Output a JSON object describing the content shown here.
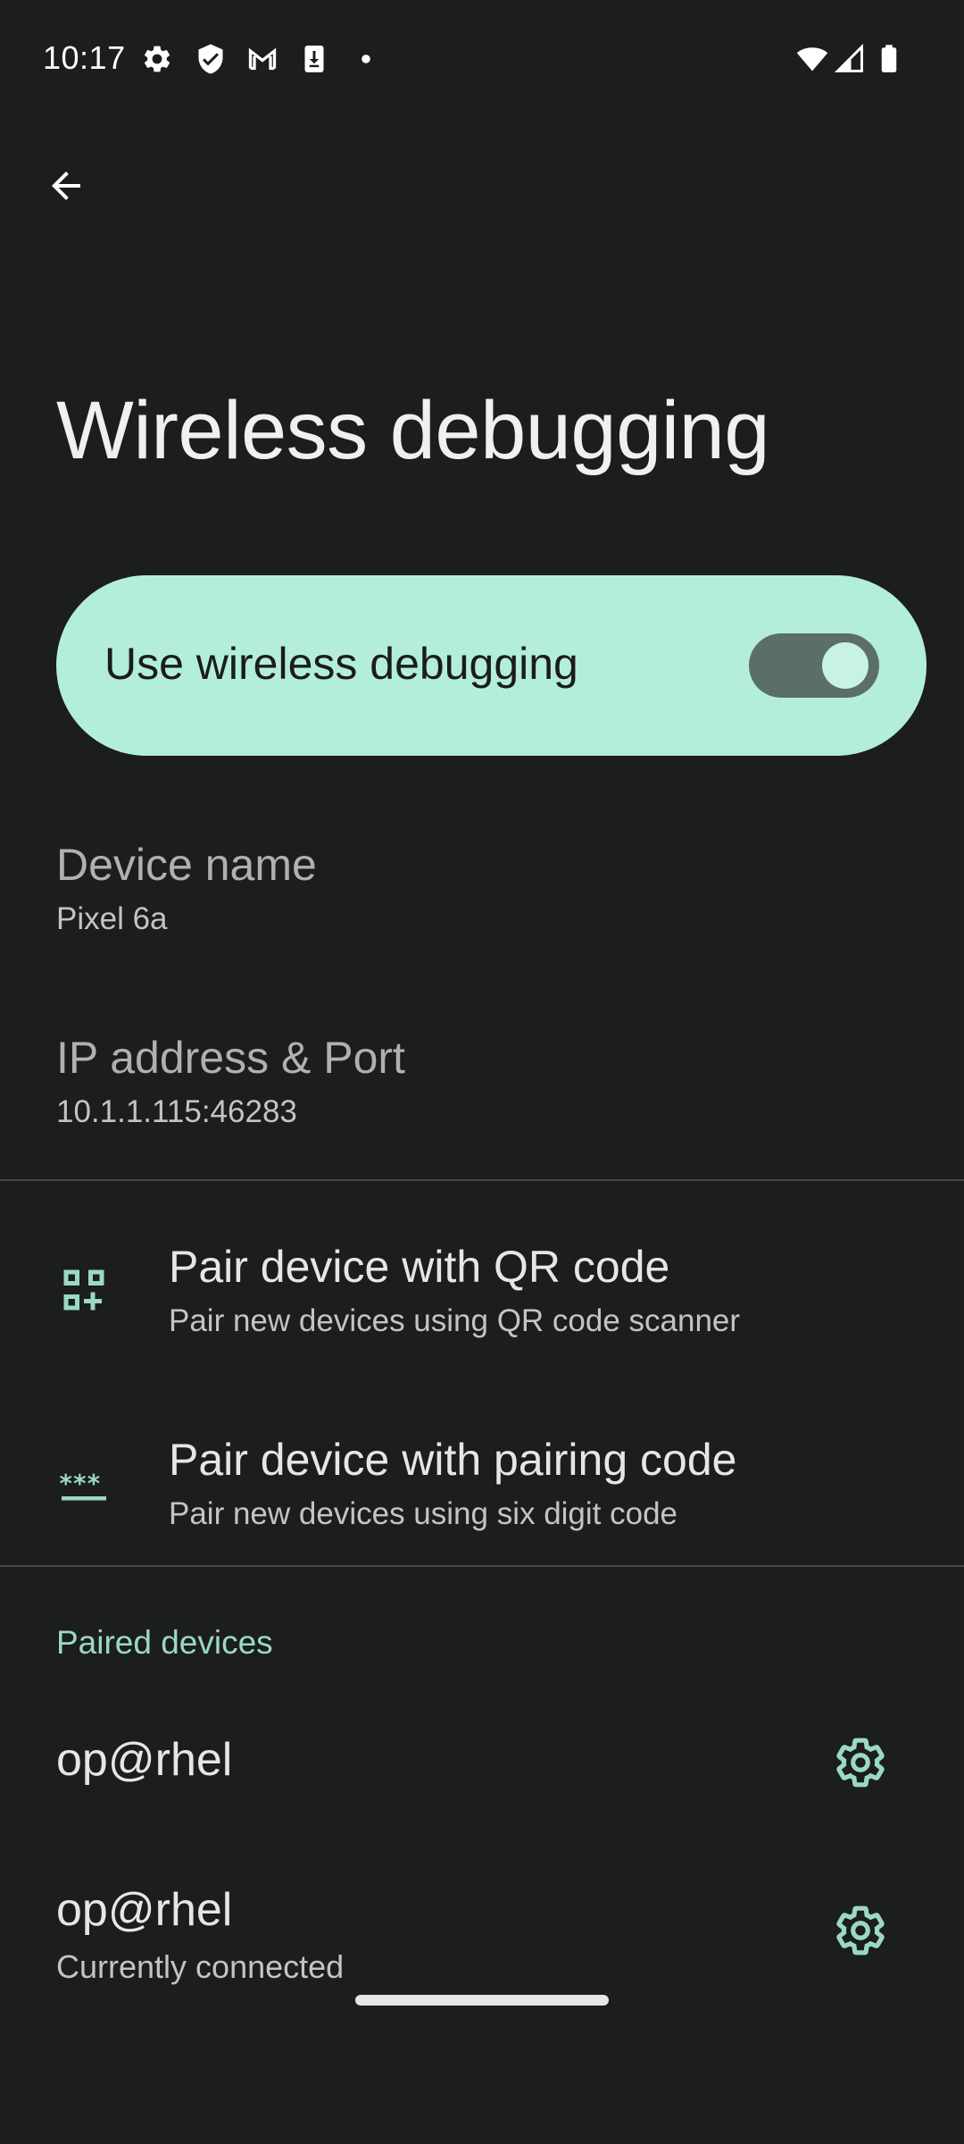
{
  "status_bar": {
    "time": "10:17",
    "left_icons": [
      "settings-gear-icon",
      "shield-icon",
      "gmail-icon",
      "download-icon",
      "notification-dot-icon"
    ],
    "right_icons": [
      "wifi-icon",
      "cell-signal-icon",
      "battery-icon"
    ]
  },
  "header": {
    "title": "Wireless debugging"
  },
  "main_switch": {
    "label": "Use wireless debugging",
    "enabled": true,
    "accent_color": "#b3eedb"
  },
  "info": {
    "device_name": {
      "title": "Device name",
      "value": "Pixel 6a"
    },
    "ip_port": {
      "title": "IP address & Port",
      "value": "10.1.1.115:46283"
    }
  },
  "actions": [
    {
      "icon": "qr-code-icon",
      "title": "Pair device with QR code",
      "subtitle": "Pair new devices using QR code scanner"
    },
    {
      "icon": "pairing-code-icon",
      "title": "Pair device with pairing code",
      "subtitle": "Pair new devices using six digit code"
    }
  ],
  "paired_devices": {
    "header": "Paired devices",
    "items": [
      {
        "name": "op@rhel",
        "status": ""
      },
      {
        "name": "op@rhel",
        "status": "Currently connected"
      }
    ]
  },
  "colors": {
    "background": "#1c1d1d",
    "accent": "#9ad9c3",
    "switch_card": "#b3eedb"
  }
}
